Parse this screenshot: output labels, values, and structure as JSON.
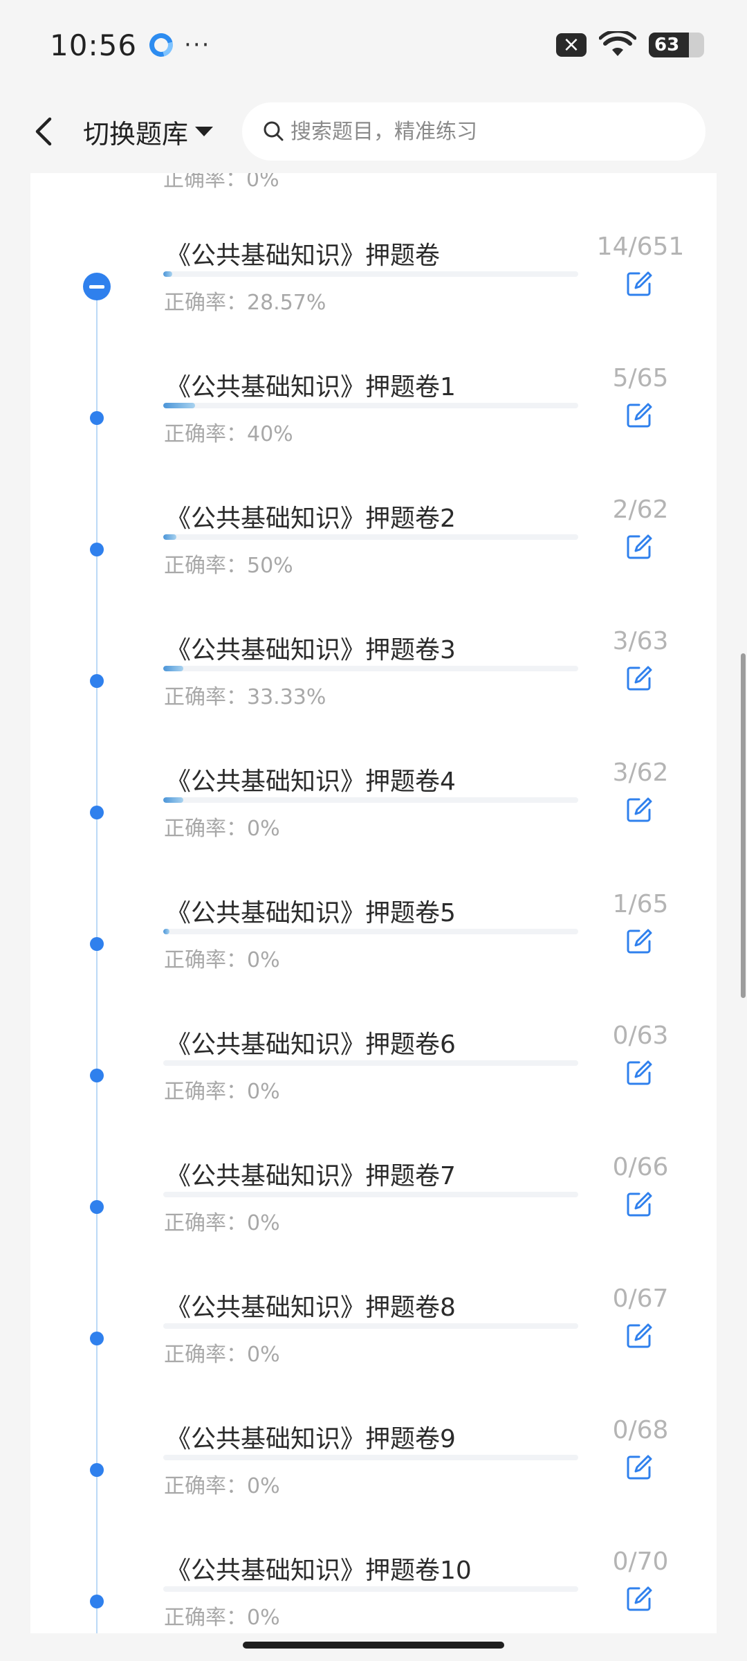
{
  "status_bar": {
    "time": "10:56",
    "more": "···",
    "battery": "63",
    "close_glyph": "×"
  },
  "header": {
    "switch_label": "切换题库",
    "search_placeholder": "搜索题目，精准练习"
  },
  "list": {
    "partial_top_accuracy": "正确率：0%",
    "items": [
      {
        "title": "《公共基础知识》押题卷",
        "accuracy": "正确率：28.57%",
        "count": "14/651",
        "progress": 0.0215,
        "active": true
      },
      {
        "title": "《公共基础知识》押题卷1",
        "accuracy": "正确率：40%",
        "count": "5/65",
        "progress": 0.077,
        "active": false
      },
      {
        "title": "《公共基础知识》押题卷2",
        "accuracy": "正确率：50%",
        "count": "2/62",
        "progress": 0.032,
        "active": false
      },
      {
        "title": "《公共基础知识》押题卷3",
        "accuracy": "正确率：33.33%",
        "count": "3/63",
        "progress": 0.048,
        "active": false
      },
      {
        "title": "《公共基础知识》押题卷4",
        "accuracy": "正确率：0%",
        "count": "3/62",
        "progress": 0.048,
        "active": false
      },
      {
        "title": "《公共基础知识》押题卷5",
        "accuracy": "正确率：0%",
        "count": "1/65",
        "progress": 0.015,
        "active": false
      },
      {
        "title": "《公共基础知识》押题卷6",
        "accuracy": "正确率：0%",
        "count": "0/63",
        "progress": 0,
        "active": false
      },
      {
        "title": "《公共基础知识》押题卷7",
        "accuracy": "正确率：0%",
        "count": "0/66",
        "progress": 0,
        "active": false
      },
      {
        "title": "《公共基础知识》押题卷8",
        "accuracy": "正确率：0%",
        "count": "0/67",
        "progress": 0,
        "active": false
      },
      {
        "title": "《公共基础知识》押题卷9",
        "accuracy": "正确率：0%",
        "count": "0/68",
        "progress": 0,
        "active": false
      },
      {
        "title": "《公共基础知识》押题卷10",
        "accuracy": "正确率：0%",
        "count": "0/70",
        "progress": 0,
        "active": false
      }
    ]
  },
  "colors": {
    "accent": "#2f80ed",
    "timeline": "#bcd9f6",
    "muted_text": "#a8a8a8"
  },
  "icons": {
    "back": "chevron-left-icon",
    "dropdown": "caret-down-icon",
    "search": "search-icon",
    "edit": "edit-icon",
    "wifi": "wifi-icon"
  }
}
